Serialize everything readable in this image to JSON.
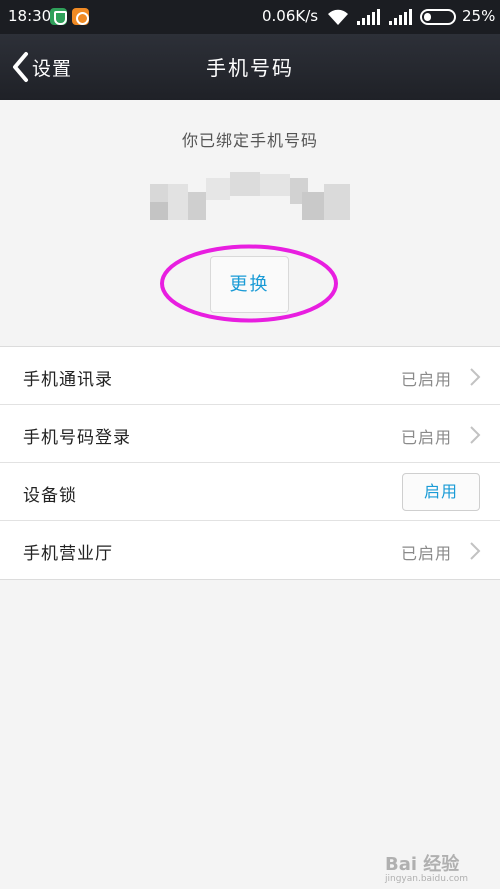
{
  "status_bar": {
    "time": "18:30",
    "net_speed": "0.06K/s",
    "battery_percent": "25%",
    "battery_level": 0.25,
    "icons": [
      "shield-app-icon",
      "orange-app-icon",
      "wifi-icon",
      "signal-icon",
      "signal-icon",
      "battery-icon"
    ]
  },
  "nav": {
    "back_label": "设置",
    "title": "手机号码"
  },
  "header": {
    "bound_label": "你已绑定手机号码",
    "change_button": "更换",
    "highlight_color": "#e81ee0"
  },
  "settings": [
    {
      "label": "手机通讯录",
      "status": "已启用"
    },
    {
      "label": "手机号码登录",
      "status": "已启用"
    },
    {
      "label": "设备锁",
      "button": "启用"
    },
    {
      "label": "手机营业厅",
      "status": "已启用"
    }
  ],
  "watermark": {
    "text": "Bai 经验",
    "sub": "jingyan.baidu.com"
  },
  "colors": {
    "accent": "#1a9bd6",
    "nav_bg": "#24272d",
    "page_bg": "#f4f4f4"
  }
}
